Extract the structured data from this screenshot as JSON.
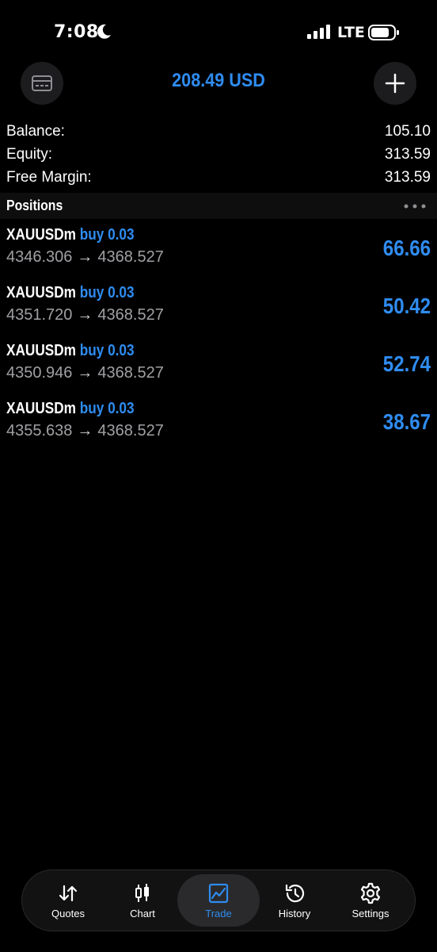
{
  "status_bar": {
    "time": "7:08",
    "network": "LTE"
  },
  "header": {
    "title": "208.49 USD",
    "accent_color": "#2f8cf0"
  },
  "summary": [
    {
      "label": "Balance:",
      "value": "105.10"
    },
    {
      "label": "Equity:",
      "value": "313.59"
    },
    {
      "label": "Free Margin:",
      "value": "313.59"
    }
  ],
  "positions": {
    "title": "Positions",
    "items": [
      {
        "symbol": "XAUUSDm",
        "direction": "buy 0.03",
        "open_price": "4346.306",
        "arrow": "→",
        "current_price": "4368.527",
        "profit": "66.66"
      },
      {
        "symbol": "XAUUSDm",
        "direction": "buy 0.03",
        "open_price": "4351.720",
        "arrow": "→",
        "current_price": "4368.527",
        "profit": "50.42"
      },
      {
        "symbol": "XAUUSDm",
        "direction": "buy 0.03",
        "open_price": "4350.946",
        "arrow": "→",
        "current_price": "4368.527",
        "profit": "52.74"
      },
      {
        "symbol": "XAUUSDm",
        "direction": "buy 0.03",
        "open_price": "4355.638",
        "arrow": "→",
        "current_price": "4368.527",
        "profit": "38.67"
      }
    ]
  },
  "tabs": [
    {
      "label": "Quotes",
      "icon": "quotes-icon"
    },
    {
      "label": "Chart",
      "icon": "candlestick-icon"
    },
    {
      "label": "Trade",
      "icon": "trade-icon",
      "active": true
    },
    {
      "label": "History",
      "icon": "history-icon"
    },
    {
      "label": "Settings",
      "icon": "gear-icon"
    }
  ]
}
